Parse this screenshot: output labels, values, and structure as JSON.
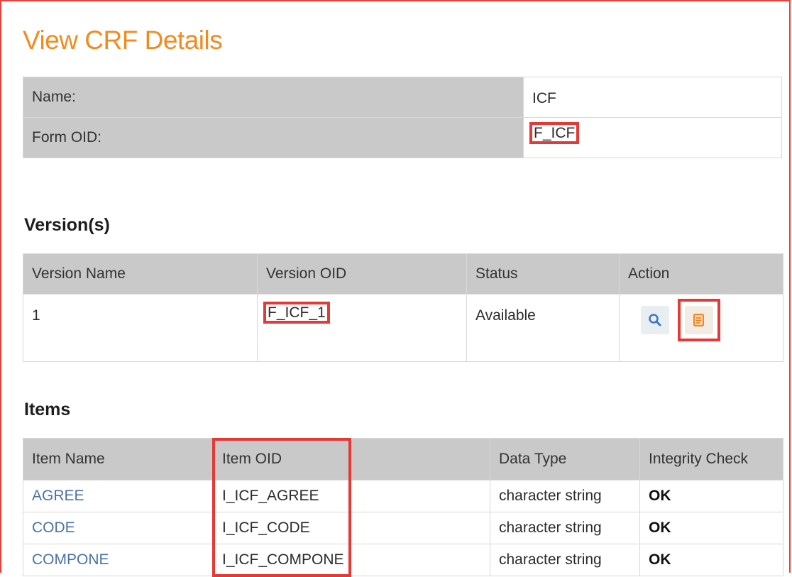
{
  "page": {
    "title": "View CRF Details"
  },
  "crf": {
    "name_label": "Name:",
    "name_value": "ICF",
    "oid_label": "Form OID:",
    "oid_value": "F_ICF"
  },
  "versions": {
    "title": "Version(s)",
    "headers": [
      "Version Name",
      "Version OID",
      "Status",
      "Action"
    ],
    "rows": [
      {
        "name": "1",
        "oid": "F_ICF_1",
        "status": "Available"
      }
    ],
    "actions": {
      "view_icon": "magnifier-icon",
      "print_icon": "document-icon"
    }
  },
  "items": {
    "title": "Items",
    "headers": [
      "Item Name",
      "Item OID",
      "Data Type",
      "Integrity Check"
    ],
    "rows": [
      {
        "name": "AGREE",
        "oid": "I_ICF_AGREE",
        "type": "character string",
        "check": "OK"
      },
      {
        "name": "CODE",
        "oid": "I_ICF_CODE",
        "type": "character string",
        "check": "OK"
      },
      {
        "name": "COMPONE",
        "oid": "I_ICF_COMPONE",
        "type": "character string",
        "check": "OK"
      }
    ]
  },
  "colors": {
    "title": "#f28b1e",
    "link": "#4b72a6",
    "highlight": "#e53935",
    "header_bg": "#c9c9c9"
  }
}
